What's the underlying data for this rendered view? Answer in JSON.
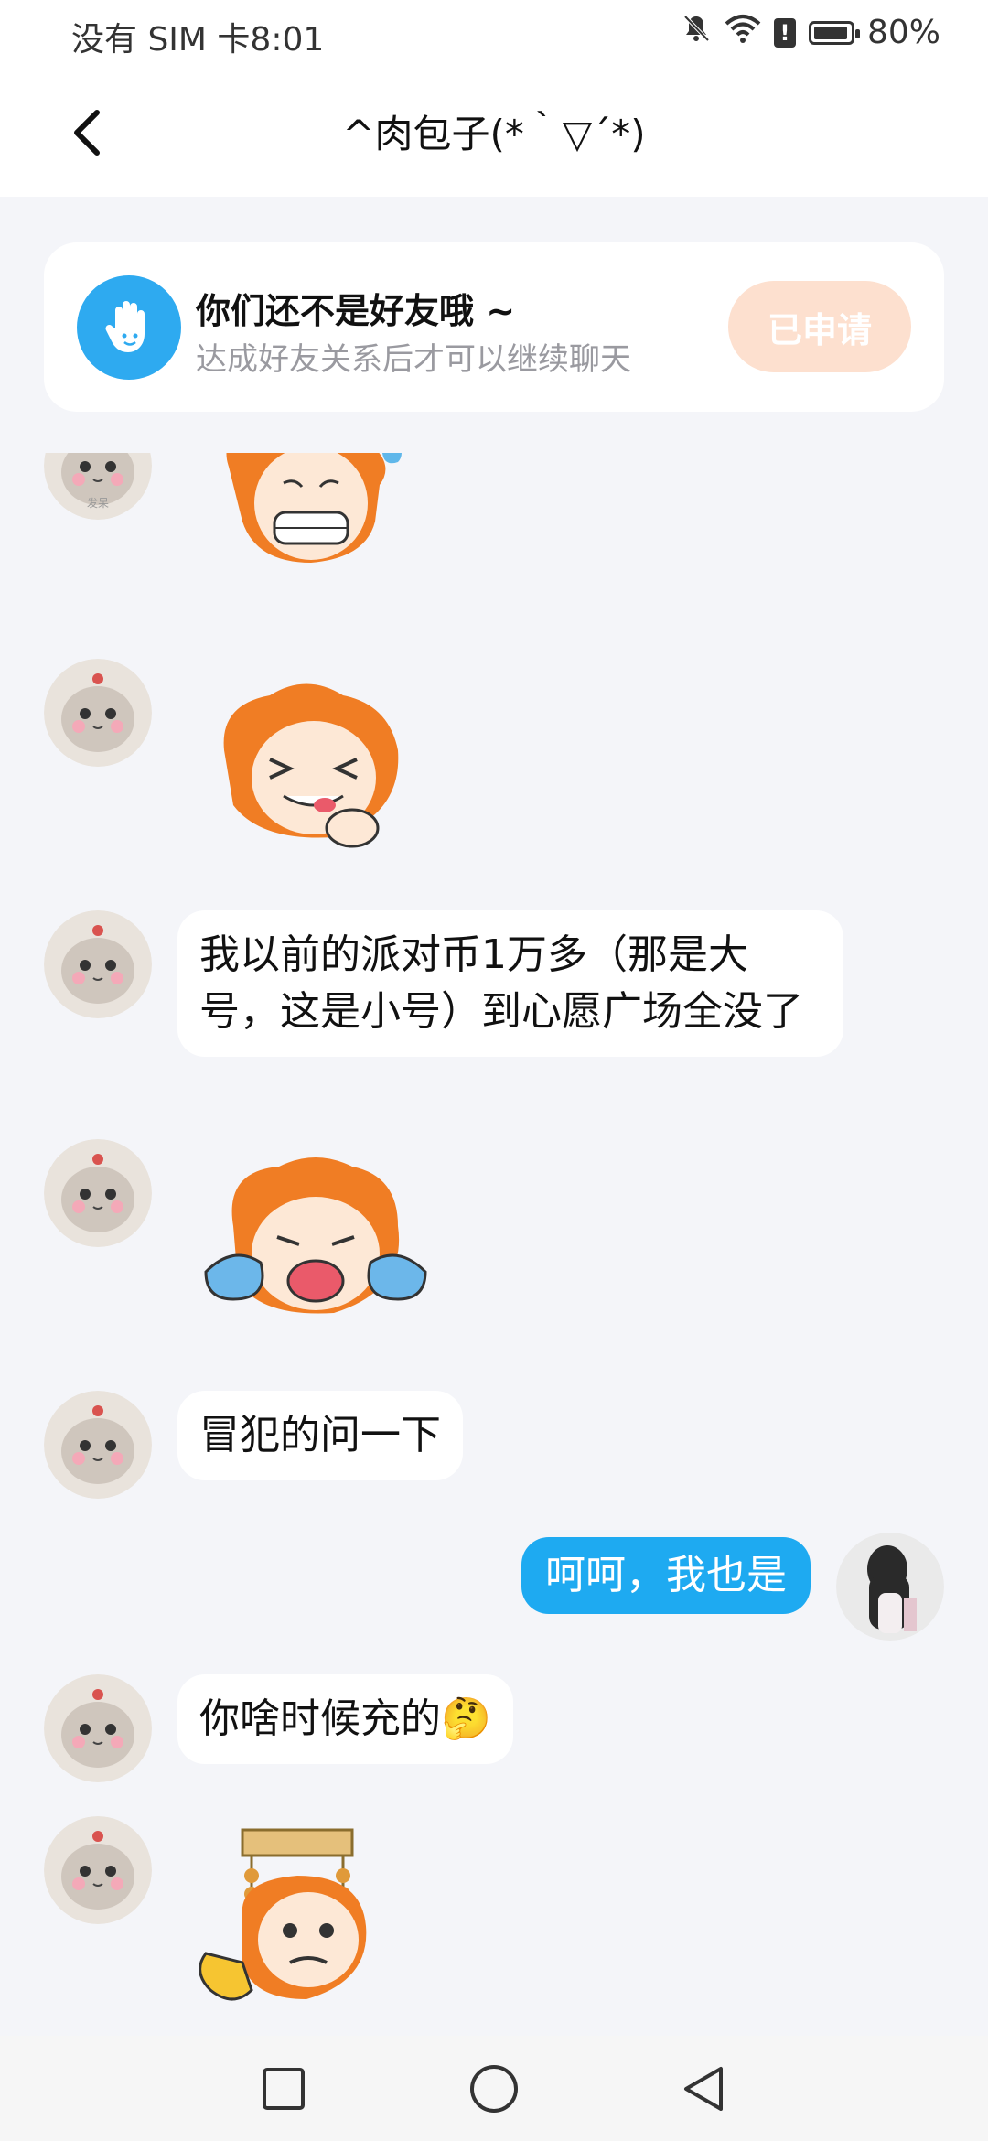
{
  "status_bar": {
    "carrier_time": "没有 SIM 卡8:01",
    "battery": "80%",
    "battery_level": 0.8,
    "icons": [
      "bell-muted-icon",
      "wifi-icon",
      "alert-icon",
      "battery-icon"
    ]
  },
  "header": {
    "title": "^肉包子(*｀▽´*)"
  },
  "banner": {
    "title": "你们还不是好友哦 ~",
    "subtitle": "达成好友关系后才可以继续聊天",
    "button": "已申请"
  },
  "messages": [
    {
      "from": "other",
      "type": "sticker",
      "sticker": "sweat-grimace-sticker"
    },
    {
      "from": "other",
      "type": "sticker",
      "sticker": "laughing-tongue-sticker"
    },
    {
      "from": "other",
      "type": "text",
      "text": "我以前的派对币1万多（那是大号，这是小号）到心愿广场全没了"
    },
    {
      "from": "other",
      "type": "sticker",
      "sticker": "crying-sticker"
    },
    {
      "from": "other",
      "type": "text",
      "text": "冒犯的问一下"
    },
    {
      "from": "me",
      "type": "text",
      "text": "呵呵，我也是"
    },
    {
      "from": "other",
      "type": "text",
      "text": "你啥时候充的🤔"
    },
    {
      "from": "other",
      "type": "sticker",
      "sticker": "emperor-ok-sticker"
    }
  ],
  "avatar_caption": "发呆",
  "colors": {
    "accent": "#1eaaf1",
    "applied_button": "#fde0cf",
    "background": "#f4f5f9"
  }
}
